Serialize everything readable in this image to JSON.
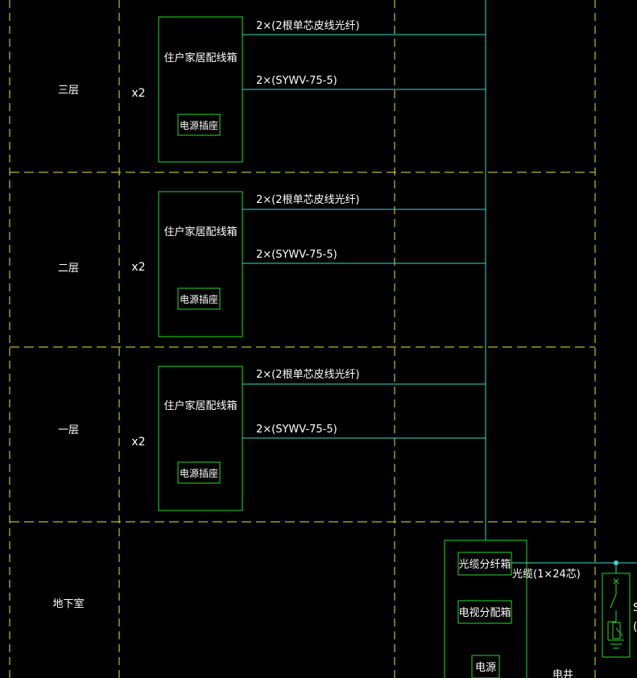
{
  "colors": {
    "background": "#000000",
    "grid_dashed": "#e6e632",
    "box_outline": "#22dd22",
    "cable": "#33ddcc",
    "text": "#ffffff"
  },
  "floors": [
    {
      "name": "三层",
      "count": "x2",
      "box_label": "住户家居配线箱",
      "socket_label": "电源插座",
      "fiber_label": "2×(2根单芯皮线光纤)",
      "coax_label": "2×(SYWV-75-5)"
    },
    {
      "name": "二层",
      "count": "x2",
      "box_label": "住户家居配线箱",
      "socket_label": "电源插座",
      "fiber_label": "2×(2根单芯皮线光纤)",
      "coax_label": "2×(SYWV-75-5)"
    },
    {
      "name": "一层",
      "count": "x2",
      "box_label": "住户家居配线箱",
      "socket_label": "电源插座",
      "fiber_label": "2×(2根单芯皮线光纤)",
      "coax_label": "2×(SYWV-75-5)"
    }
  ],
  "basement": {
    "name": "地下室",
    "fiber_box_label": "光缆分纤箱",
    "tv_box_label": "电视分配箱",
    "power_label": "电源",
    "trunk_cable_label": "光缆(1×24芯)",
    "shaft_label": "电井",
    "cut_label_1": "S",
    "cut_label_2": "("
  }
}
